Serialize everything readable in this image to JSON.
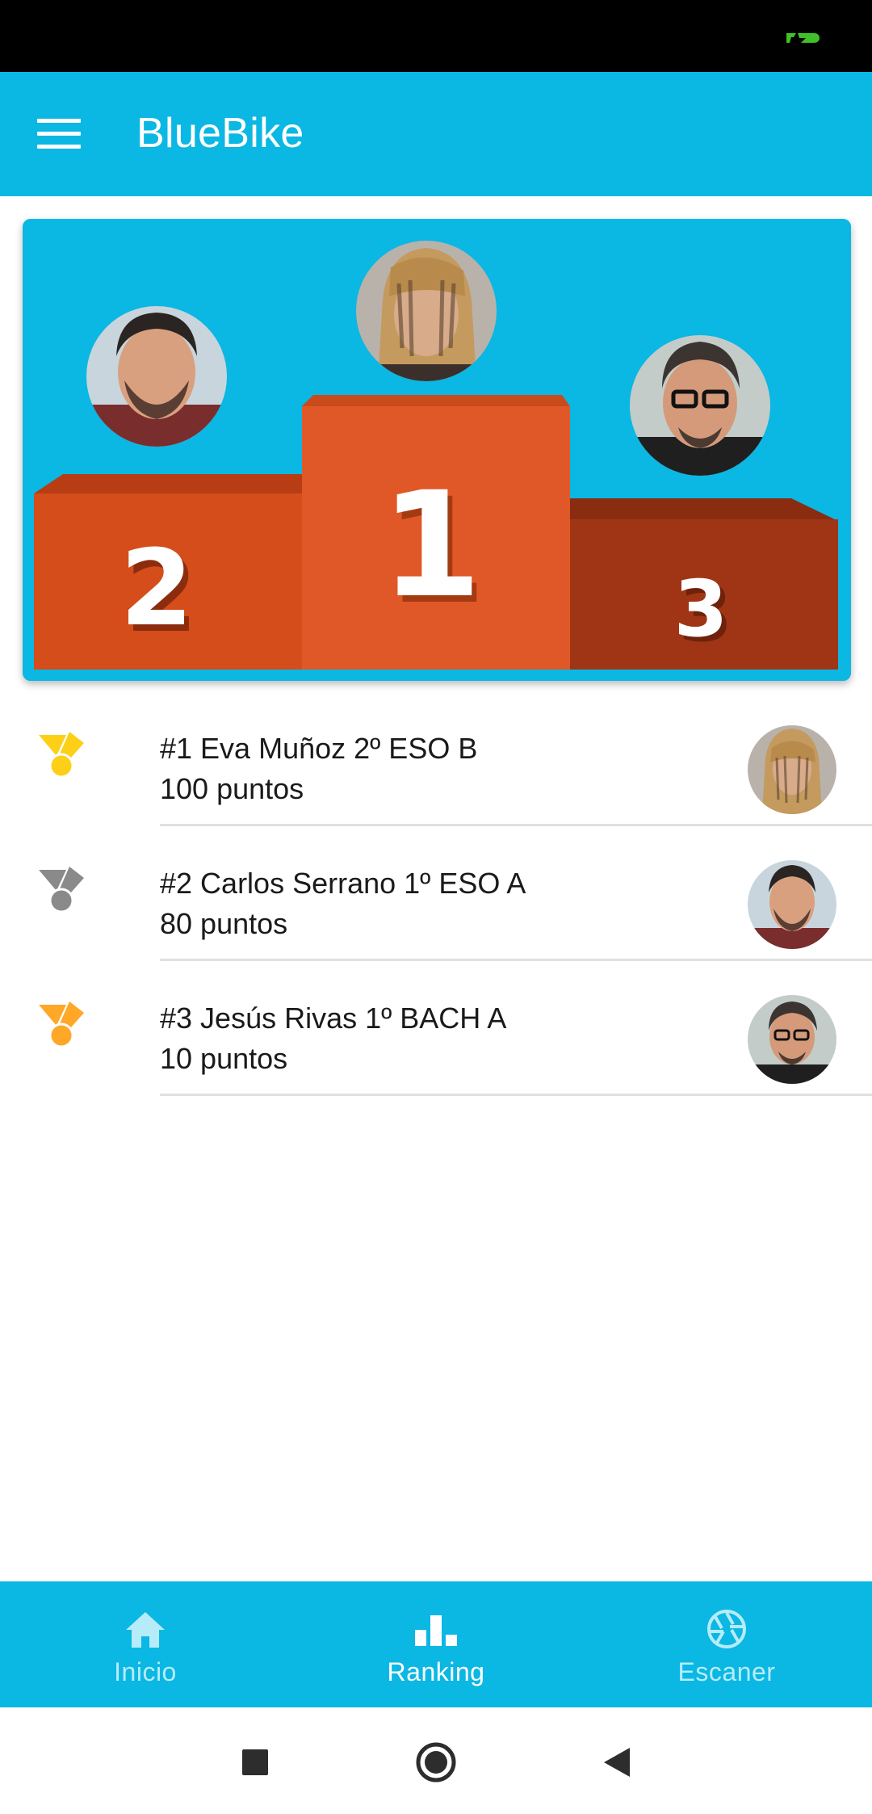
{
  "app": {
    "title": "BlueBike",
    "accent_color": "#0bb7e3"
  },
  "status_bar": {
    "icons": [
      "battery-charging-icon"
    ]
  },
  "podium": {
    "places": [
      {
        "number": "2",
        "color": "#d44d1b",
        "avatar": "avatar-carlos"
      },
      {
        "number": "1",
        "color": "#e05827",
        "avatar": "avatar-eva"
      },
      {
        "number": "3",
        "color": "#a03515",
        "avatar": "avatar-jesus"
      }
    ]
  },
  "ranking": {
    "items": [
      {
        "title": "#1 Eva Muñoz 2º ESO B",
        "subtitle": "100 puntos",
        "medal_color": "#fdd017",
        "medal_icon": "gold-medal-icon"
      },
      {
        "title": "#2 Carlos Serrano 1º ESO A",
        "subtitle": "80 puntos",
        "medal_color": "#8a8a8a",
        "medal_icon": "silver-medal-icon"
      },
      {
        "title": "#3 Jesús Rivas 1º BACH A",
        "subtitle": "10 puntos",
        "medal_color": "#ffa726",
        "medal_icon": "bronze-medal-icon"
      }
    ]
  },
  "bottom_nav": {
    "items": [
      {
        "label": "Inicio",
        "icon": "home-icon",
        "active": false
      },
      {
        "label": "Ranking",
        "icon": "bar-chart-icon",
        "active": true
      },
      {
        "label": "Escaner",
        "icon": "camera-shutter-icon",
        "active": false
      }
    ]
  },
  "system_nav": {
    "buttons": [
      "recents-square-icon",
      "home-circle-icon",
      "back-triangle-icon"
    ]
  }
}
